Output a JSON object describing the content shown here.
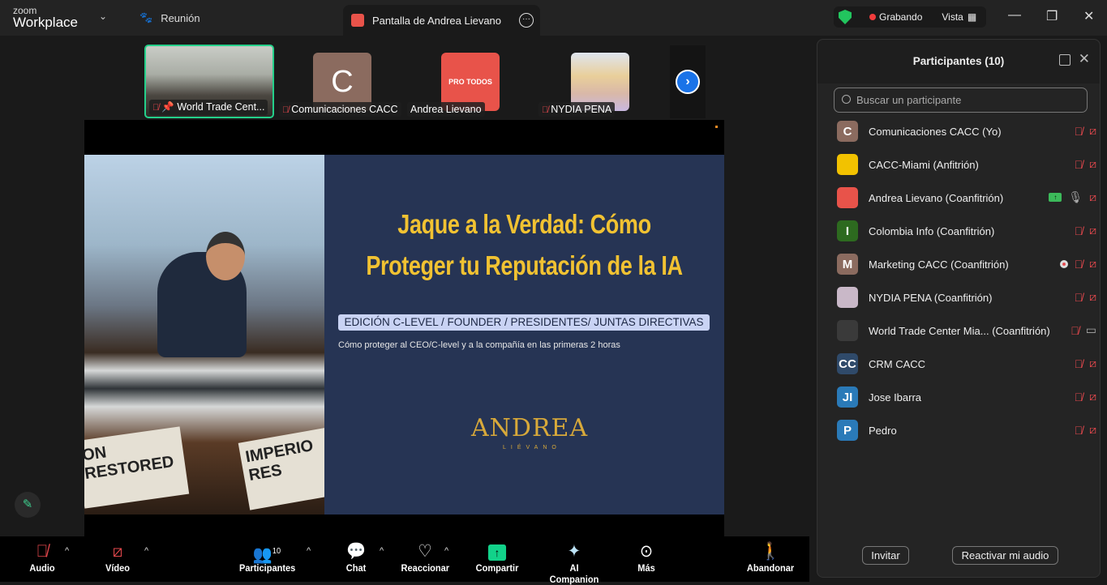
{
  "topbar": {
    "logo_top": "zoom",
    "logo_bottom": "Workplace",
    "meeting_label": "Reunión",
    "share_tab": "Pantalla de Andrea Lievano",
    "more": "···",
    "recording": "Grabando",
    "view": "Vista",
    "minimize": "—",
    "restore": "❐",
    "close": "✕"
  },
  "thumbnails": [
    {
      "label": "World Trade Cent..."
    },
    {
      "initial": "C",
      "label": "Comunicaciones CACC",
      "color": "#8b6b5f"
    },
    {
      "initial": "PRO TODOS",
      "label": "Andrea Lievano",
      "color": "#e8534a"
    },
    {
      "label": "NYDIA PENA"
    }
  ],
  "slide": {
    "title_line1": "Jaque a la Verdad: Cómo",
    "title_line2": "Proteger tu Reputación de la IA",
    "pill": "EDICIÓN C-LEVEL / FOUNDER / PRESIDENTES/ JUNTAS DIRECTIVAS",
    "subtitle": "Cómo proteger al CEO/C-level y a la compañía en las primeras 2 horas",
    "brand": "ANDREA",
    "brand_sub": "LIÉVANO",
    "newspaper1": "ON RESTORED",
    "newspaper2": "IMPERIO RES"
  },
  "toolbar": {
    "audio": "Audio",
    "video": "Vídeo",
    "participants": "Participantes",
    "participants_count": "10",
    "chat": "Chat",
    "react": "Reaccionar",
    "share": "Compartir",
    "ai": "AI Companion",
    "more": "Más",
    "leave": "Abandonar"
  },
  "panel": {
    "title": "Participantes (10)",
    "search_placeholder": "Buscar un participante",
    "invite": "Invitar",
    "unmute": "Reactivar mi audio",
    "participants": [
      {
        "initial": "C",
        "name": "Comunicaciones CACC (Yo)",
        "color": "#8b6b5f",
        "mic": "off",
        "video": "off"
      },
      {
        "initial": "",
        "name": "CACC-Miami (Anfitrión)",
        "color": "#f2c200",
        "mic": "off",
        "video": "off"
      },
      {
        "initial": "",
        "name": "Andrea Lievano (Coanfitrión)",
        "color": "#e8534a",
        "mic": "on",
        "video": "off",
        "sharing": true
      },
      {
        "initial": "I",
        "name": "Colombia Info (Coanfitrión)",
        "color": "#2d6a1f",
        "mic": "off",
        "video": "off"
      },
      {
        "initial": "M",
        "name": "Marketing CACC (Coanfitrión)",
        "color": "#8b6b5f",
        "mic": "off",
        "video": "off",
        "recording": true
      },
      {
        "initial": "",
        "name": "NYDIA PENA (Coanfitrión)",
        "color": "#c9b8c8",
        "mic": "off",
        "video": "off"
      },
      {
        "initial": "",
        "name": "World Trade Center Mia...  (Coanfitrión)",
        "color": "#3a3a3a",
        "mic": "off",
        "video": "on"
      },
      {
        "initial": "CC",
        "name": "CRM CACC",
        "color": "#2f4a6a",
        "mic": "off",
        "video": "off"
      },
      {
        "initial": "JI",
        "name": "Jose Ibarra",
        "color": "#2a7ab8",
        "mic": "off",
        "video": "off"
      },
      {
        "initial": "P",
        "name": "Pedro",
        "color": "#2a7ab8",
        "mic": "off",
        "video": "off"
      }
    ]
  }
}
